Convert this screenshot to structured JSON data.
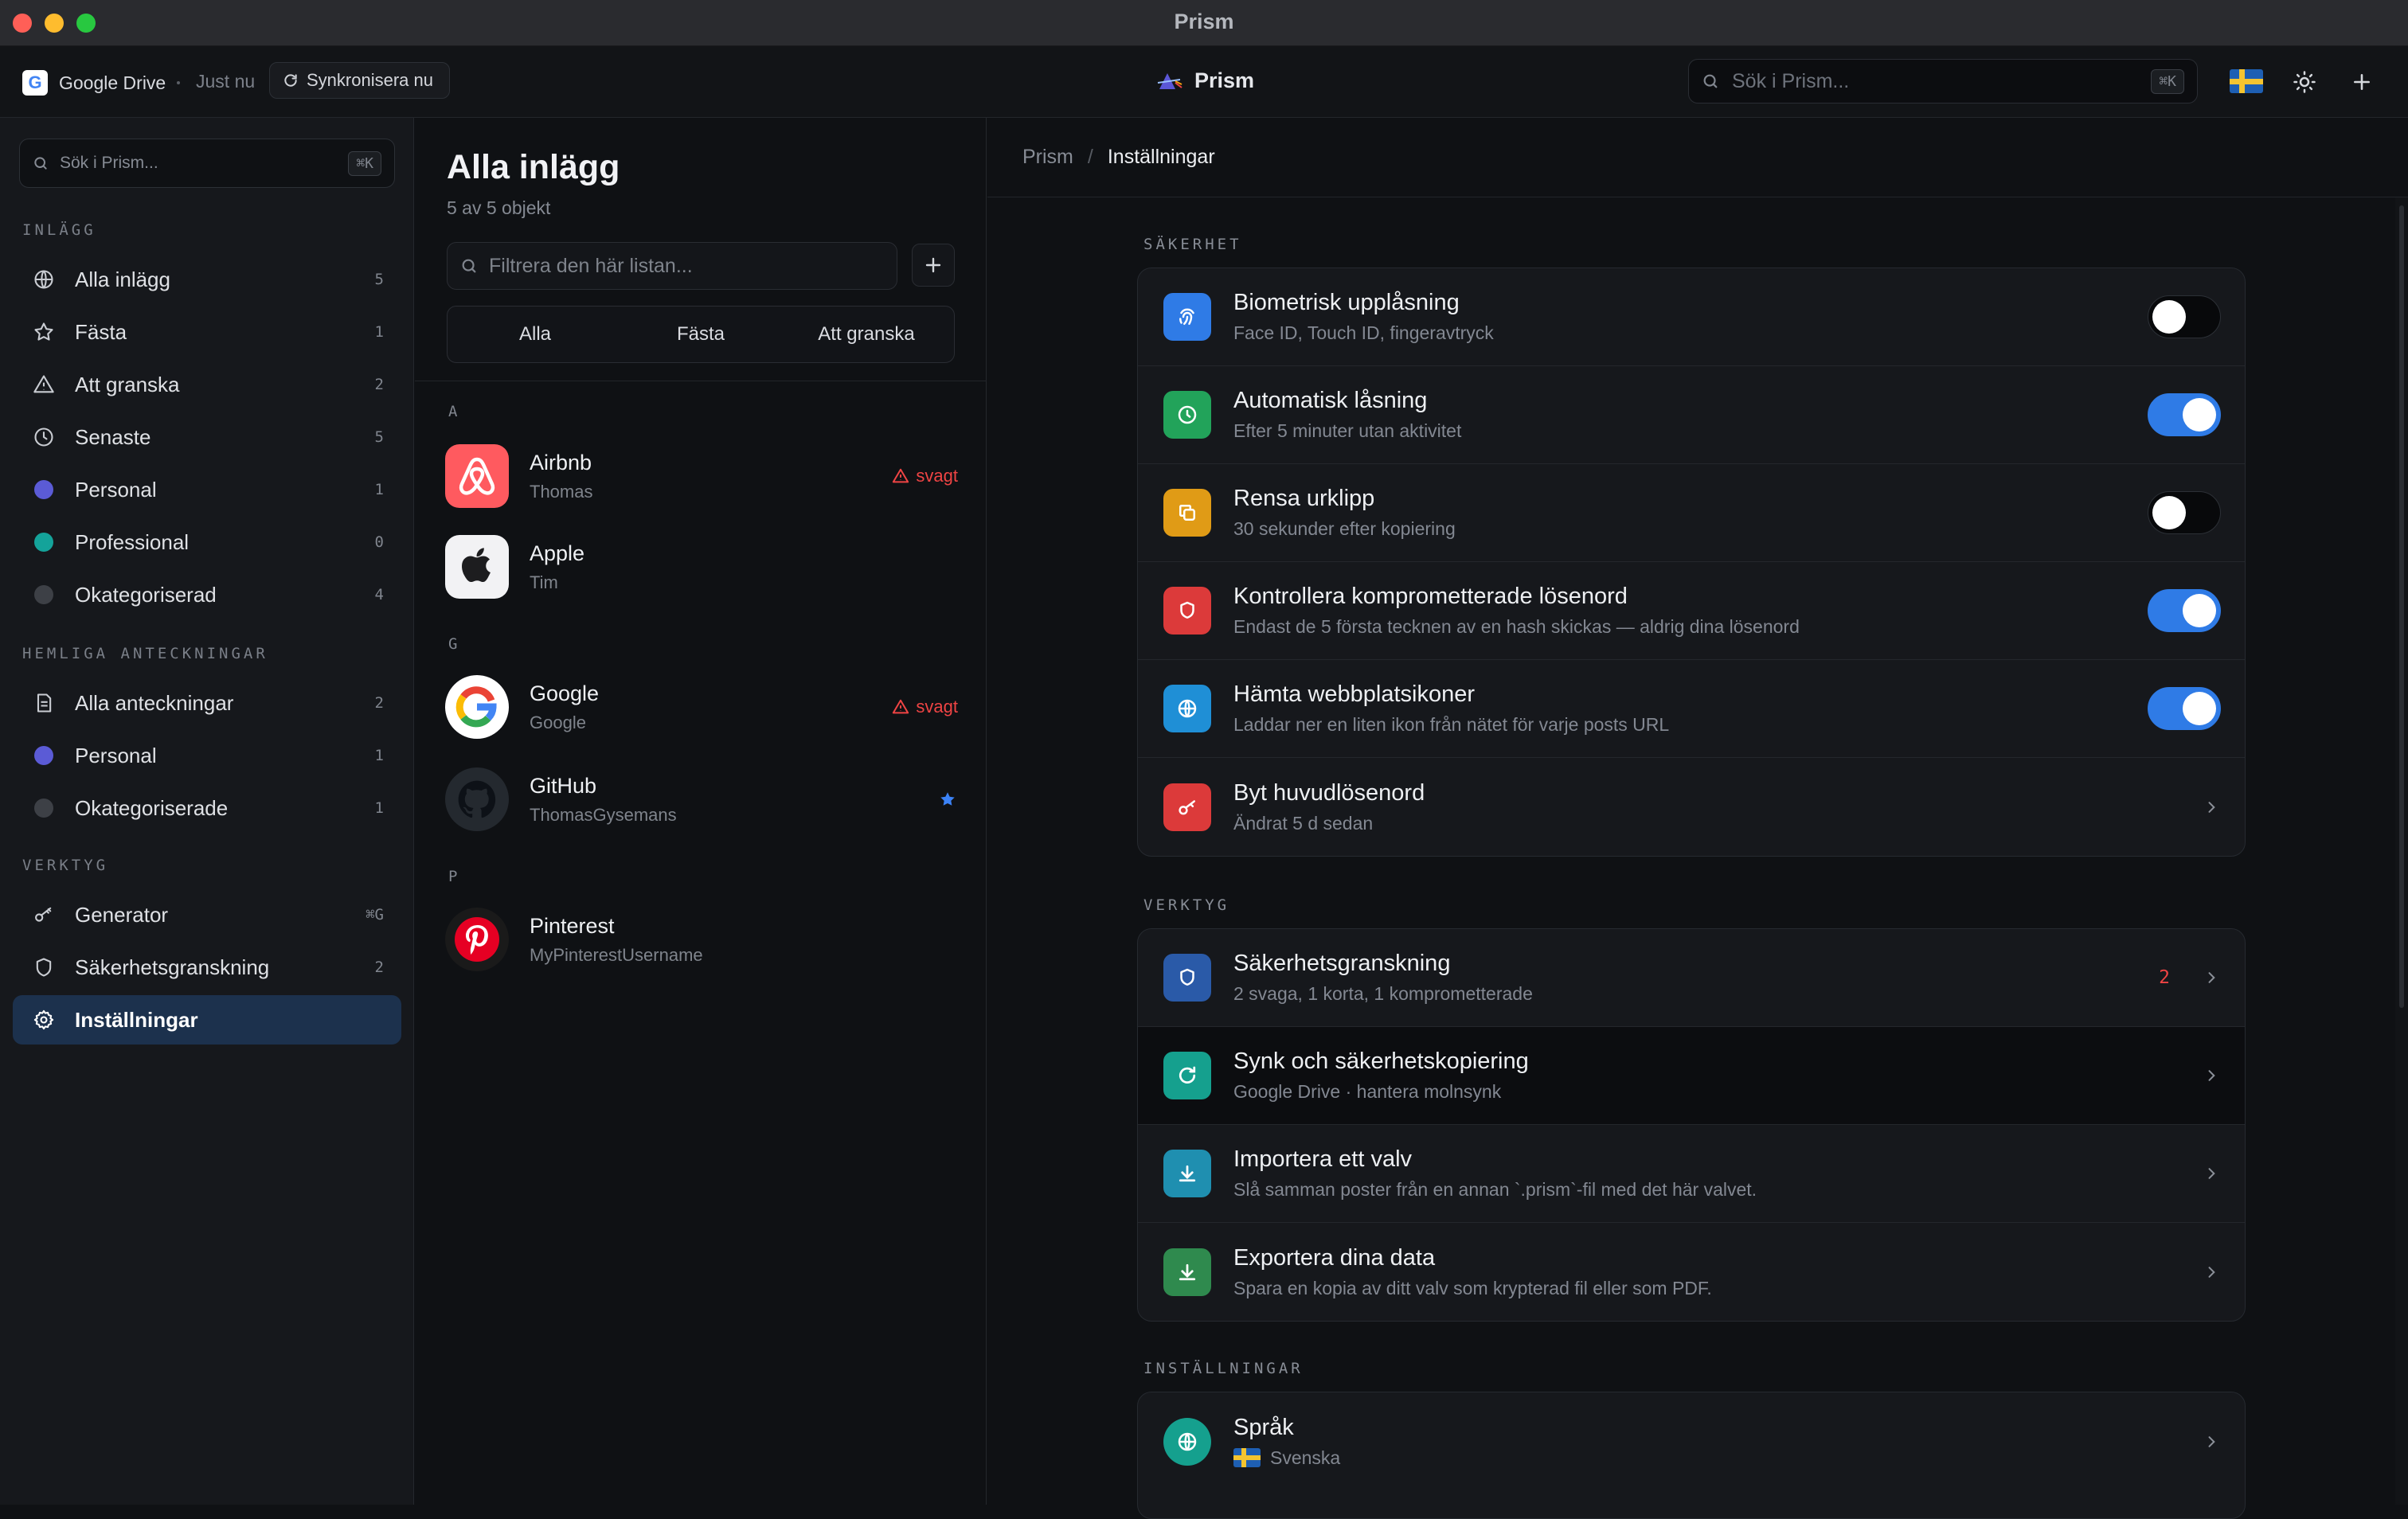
{
  "window": {
    "title": "Prism"
  },
  "toolbar": {
    "provider": "Google Drive",
    "provider_icon": "google-drive-icon",
    "last_sync": "Just nu",
    "sync_button": "Synkronisera nu",
    "app_name": "Prism",
    "search_placeholder": "Sök i Prism...",
    "search_shortcut": "⌘K"
  },
  "sidebar": {
    "search_placeholder": "Sök i Prism...",
    "search_shortcut": "⌘K",
    "sections": {
      "posts": "INLÄGG",
      "secret_notes": "HEMLIGA ANTECKNINGAR",
      "tools": "VERKTYG"
    },
    "posts": [
      {
        "label": "Alla inlägg",
        "count": "5",
        "icon": "globe-icon"
      },
      {
        "label": "Fästa",
        "count": "1",
        "icon": "star-icon"
      },
      {
        "label": "Att granska",
        "count": "2",
        "icon": "warning-icon"
      },
      {
        "label": "Senaste",
        "count": "5",
        "icon": "clock-icon"
      },
      {
        "label": "Personal",
        "count": "1",
        "color": "#5b5bd6"
      },
      {
        "label": "Professional",
        "count": "0",
        "color": "#14a39a"
      },
      {
        "label": "Okategoriserad",
        "count": "4",
        "color": "#3d4046"
      }
    ],
    "notes": [
      {
        "label": "Alla anteckningar",
        "count": "2",
        "icon": "note-icon"
      },
      {
        "label": "Personal",
        "count": "1",
        "color": "#5b5bd6"
      },
      {
        "label": "Okategoriserade",
        "count": "1",
        "color": "#3d4046"
      }
    ],
    "tools": [
      {
        "label": "Generator",
        "count": "⌘G",
        "icon": "key-icon"
      },
      {
        "label": "Säkerhetsgranskning",
        "count": "2",
        "icon": "shield-icon"
      },
      {
        "label": "Inställningar",
        "count": "",
        "icon": "gear-icon",
        "active": true
      }
    ]
  },
  "list": {
    "title": "Alla inlägg",
    "subtitle": "5 av 5 objekt",
    "filter_placeholder": "Filtrera den här listan...",
    "tabs": [
      "Alla",
      "Fästa",
      "Att granska"
    ],
    "groups": [
      {
        "letter": "A",
        "entries": [
          {
            "name": "Airbnb",
            "user": "Thomas",
            "status": "svagt",
            "logo": "airbnb-logo"
          },
          {
            "name": "Apple",
            "user": "Tim",
            "status": "",
            "logo": "apple-logo"
          }
        ]
      },
      {
        "letter": "G",
        "entries": [
          {
            "name": "Google",
            "user": "Google",
            "status": "svagt",
            "logo": "google-logo"
          },
          {
            "name": "GitHub",
            "user": "ThomasGysemans",
            "status": "",
            "pinned": true,
            "logo": "github-logo"
          }
        ]
      },
      {
        "letter": "P",
        "entries": [
          {
            "name": "Pinterest",
            "user": "MyPinterestUsername",
            "status": "",
            "logo": "pinterest-logo"
          }
        ]
      }
    ]
  },
  "detail": {
    "breadcrumb": [
      "Prism",
      "Inställningar"
    ],
    "security": {
      "heading": "SÄKERHET",
      "rows": [
        {
          "title": "Biometrisk upplåsning",
          "sub": "Face ID, Touch ID, fingeravtryck",
          "toggle": false,
          "color": "#2f7be6",
          "icon": "fingerprint-icon"
        },
        {
          "title": "Automatisk låsning",
          "sub": "Efter 5 minuter utan aktivitet",
          "toggle": true,
          "color": "#22a35a",
          "icon": "clock-icon"
        },
        {
          "title": "Rensa urklipp",
          "sub": "30 sekunder efter kopiering",
          "toggle": false,
          "color": "#e09b16",
          "icon": "copy-icon"
        },
        {
          "title": "Kontrollera komprometterade lösenord",
          "sub": "Endast de 5 första tecknen av en hash skickas — aldrig dina lösenord",
          "toggle": true,
          "color": "#dc3a3a",
          "icon": "shield-icon"
        },
        {
          "title": "Hämta webbplatsikoner",
          "sub": "Laddar ner en liten ikon från nätet för varje posts URL",
          "toggle": true,
          "color": "#1f8fd6",
          "icon": "globe-icon"
        },
        {
          "title": "Byt huvudlösenord",
          "sub": "Ändrat 5 d sedan",
          "color": "#dc3a3a",
          "icon": "key-icon"
        }
      ]
    },
    "tools": {
      "heading": "VERKTYG",
      "rows": [
        {
          "title": "Säkerhetsgranskning",
          "sub": "2 svaga, 1 korta, 1 komprometterade",
          "badge": "2",
          "color": "#2a5aa8",
          "icon": "shield-icon"
        },
        {
          "title": "Synk och säkerhetskopiering",
          "sub": "Google Drive · hantera molnsynk",
          "color": "#15a08e",
          "icon": "sync-icon"
        },
        {
          "title": "Importera ett valv",
          "sub": "Slå samman poster från en annan `.prism`-fil med det här valvet.",
          "color": "#1f8fb0",
          "icon": "download-icon"
        },
        {
          "title": "Exportera dina data",
          "sub": "Spara en kopia av ditt valv som krypterad fil eller som PDF.",
          "color": "#2f8a4e",
          "icon": "download-icon"
        }
      ]
    },
    "settings": {
      "heading": "INSTÄLLNINGAR",
      "rows": [
        {
          "title": "Språk",
          "sub": "Svenska",
          "color": "#15a08e",
          "icon": "globe-icon"
        }
      ]
    }
  }
}
